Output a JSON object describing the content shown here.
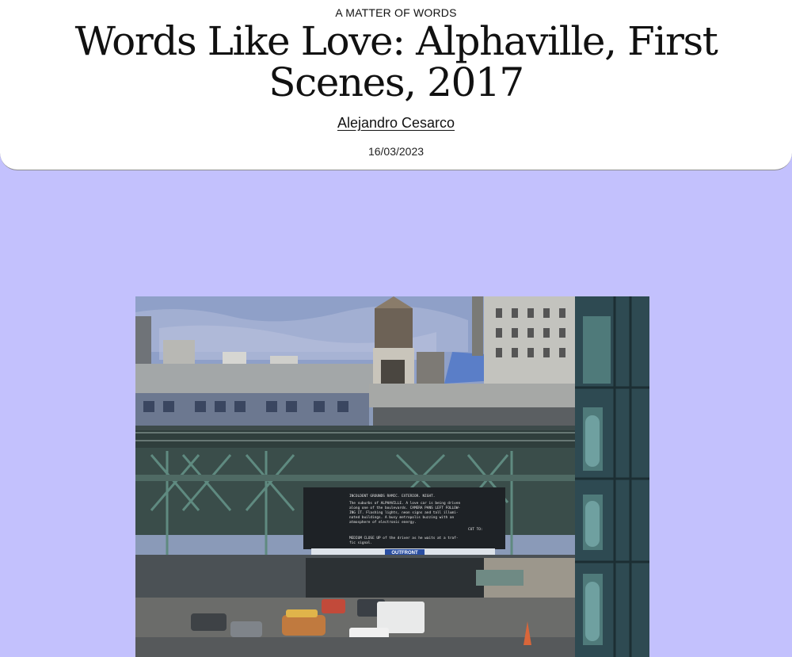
{
  "header": {
    "kicker": "A MATTER OF WORDS",
    "title": "Words Like Love: Alphaville, First Scenes, 2017",
    "author": "Alejandro Cesarco",
    "date": "16/03/2023"
  },
  "photo": {
    "billboard_lines": [
      "INCOLDENT GROUNDS RAMIC. EXTERIOR. NIGHT.",
      "The suburbs of ALPHAVILLE. A love car is being driven",
      "along one of the boulevards. CAMERA PANS LEFT FOLLOW-",
      "ING IT. Flashing lights, neon signs and tall illumi-",
      "nated buildings. A busy metropolis buzzing with an",
      "atmosphere of electronic energy.",
      "CUT TO:",
      "MEDIUM CLOSE UP of the driver as he waits at a traf-",
      "fic signal."
    ],
    "sign_label": "OUTFRONT"
  },
  "colors": {
    "page_background": "#c3c1fd",
    "header_background": "#ffffff"
  }
}
